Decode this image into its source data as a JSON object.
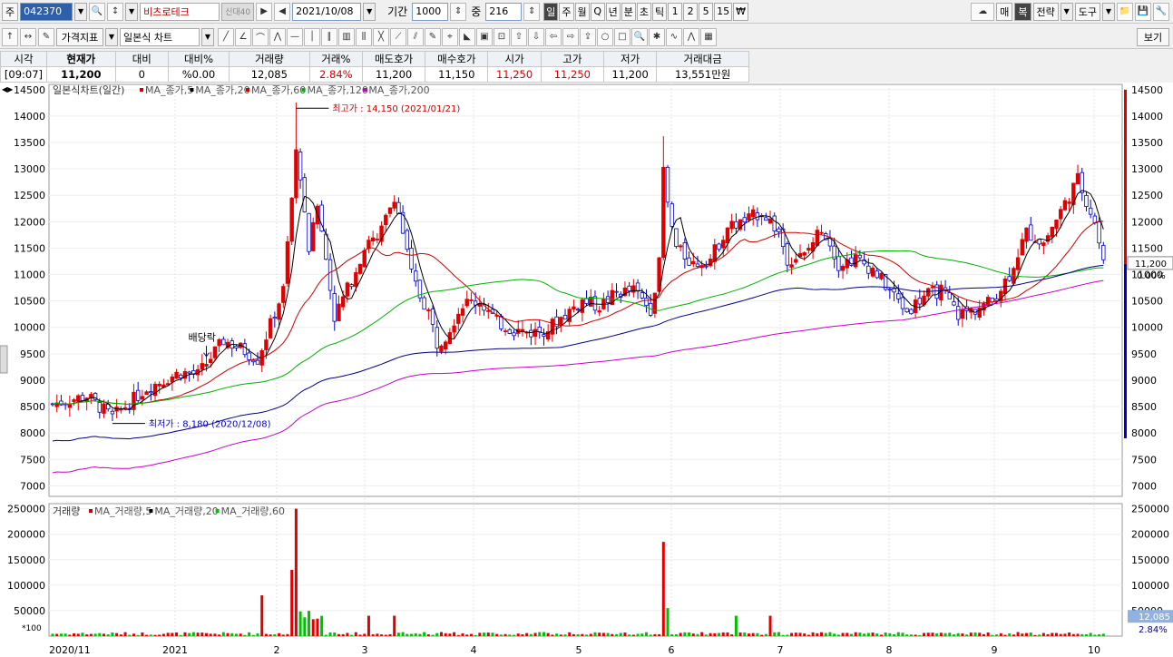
{
  "toolbar": {
    "market_label": "주",
    "code": "042370",
    "name": "비츠로테크",
    "badge": "신대40",
    "date": "2021/10/08",
    "period_label": "기간",
    "period_value": "1000",
    "count_label": "중",
    "count_value": "216",
    "period_buttons": [
      "일",
      "주",
      "월",
      "Q",
      "년",
      "분",
      "초",
      "틱",
      "1",
      "2",
      "5",
      "15",
      "₩"
    ],
    "right_buttons": [
      "매",
      "복",
      "전략",
      "도구"
    ],
    "price_indicator": "가격지표",
    "chart_type": "일본식 차트",
    "view_button": "보기"
  },
  "quote": {
    "headers": [
      "시각",
      "현재가",
      "대비",
      "대비%",
      "거래량",
      "거래%",
      "매도호가",
      "매수호가",
      "시가",
      "고가",
      "저가",
      "거래대금"
    ],
    "values": [
      "[09:07]",
      "11,200",
      "0",
      "%0.00",
      "12,085",
      "2.84%",
      "11,200",
      "11,150",
      "11,250",
      "11,250",
      "11,200",
      "13,551만원"
    ]
  },
  "chart_data": {
    "type": "candlestick",
    "title": "일본식차트(일간)",
    "legend": [
      {
        "name": "MA_종가,5",
        "color": "#d00000"
      },
      {
        "name": "MA_종가,20",
        "color": "#000000"
      },
      {
        "name": "MA_종가,60",
        "color": "#d00000"
      },
      {
        "name": "MA_종가,120",
        "color": "#00b000"
      },
      {
        "name": "MA_종가,200",
        "color": "#c800c8"
      }
    ],
    "volume_title": "거래량",
    "volume_legend": [
      {
        "name": "MA_거래량,5",
        "color": "#d00000"
      },
      {
        "name": "MA_거래량,20",
        "color": "#000000"
      },
      {
        "name": "MA_거래량,60",
        "color": "#00c000"
      }
    ],
    "price_ylim": [
      6800,
      14600
    ],
    "price_ticks": [
      7000,
      7500,
      8000,
      8500,
      9000,
      9500,
      10000,
      10500,
      11000,
      11500,
      12000,
      12500,
      13000,
      13500,
      14000,
      14500
    ],
    "volume_ylim": [
      0,
      260000
    ],
    "volume_ticks": [
      50000,
      100000,
      150000,
      200000,
      250000
    ],
    "volume_unit": "*100",
    "x_labels": [
      "2020/11",
      "2021",
      "2",
      "3",
      "4",
      "5",
      "6",
      "7",
      "8",
      "9",
      "10"
    ],
    "annotations": {
      "high": "최고가 : 14,150 (2021/01/21)",
      "low": "최저가 : 8,180 (2020/12/08)",
      "dividend": "배당락"
    },
    "last_price": "11,200",
    "last_change": "0.00%",
    "last_volume": "12,085",
    "last_volume_pct": "2.84%",
    "price_path": [
      [
        0,
        8550
      ],
      [
        8,
        8700
      ],
      [
        14,
        8300
      ],
      [
        22,
        8850
      ],
      [
        30,
        9150
      ],
      [
        34,
        9100
      ],
      [
        40,
        9750
      ],
      [
        44,
        9600
      ],
      [
        48,
        9400
      ],
      [
        54,
        10700
      ],
      [
        57,
        13300
      ],
      [
        58,
        12900
      ],
      [
        60,
        11500
      ],
      [
        62,
        12300
      ],
      [
        64,
        11300
      ],
      [
        66,
        10200
      ],
      [
        70,
        10900
      ],
      [
        74,
        11700
      ],
      [
        76,
        11600
      ],
      [
        80,
        12500
      ],
      [
        82,
        11800
      ],
      [
        84,
        11000
      ],
      [
        86,
        10600
      ],
      [
        88,
        10300
      ],
      [
        90,
        9700
      ],
      [
        92,
        9850
      ],
      [
        96,
        10450
      ],
      [
        100,
        10500
      ],
      [
        104,
        10100
      ],
      [
        108,
        9950
      ],
      [
        112,
        9900
      ],
      [
        116,
        9980
      ],
      [
        120,
        10250
      ],
      [
        124,
        10500
      ],
      [
        128,
        10400
      ],
      [
        132,
        10650
      ],
      [
        136,
        10700
      ],
      [
        140,
        10350
      ],
      [
        142,
        11200
      ],
      [
        143,
        13000
      ],
      [
        144,
        12300
      ],
      [
        146,
        11500
      ],
      [
        150,
        11200
      ],
      [
        154,
        11300
      ],
      [
        156,
        11600
      ],
      [
        158,
        11900
      ],
      [
        162,
        12000
      ],
      [
        166,
        12200
      ],
      [
        170,
        11800
      ],
      [
        172,
        11300
      ],
      [
        176,
        11350
      ],
      [
        180,
        11900
      ],
      [
        182,
        11600
      ],
      [
        184,
        11200
      ],
      [
        188,
        11300
      ],
      [
        192,
        11100
      ],
      [
        196,
        10700
      ],
      [
        200,
        10300
      ],
      [
        204,
        10600
      ],
      [
        208,
        10700
      ],
      [
        212,
        10250
      ],
      [
        216,
        10350
      ],
      [
        220,
        10500
      ],
      [
        224,
        11000
      ],
      [
        228,
        11800
      ],
      [
        232,
        11600
      ],
      [
        234,
        11900
      ],
      [
        238,
        12500
      ],
      [
        240,
        12800
      ],
      [
        242,
        12400
      ],
      [
        244,
        12000
      ],
      [
        246,
        11200
      ]
    ]
  }
}
